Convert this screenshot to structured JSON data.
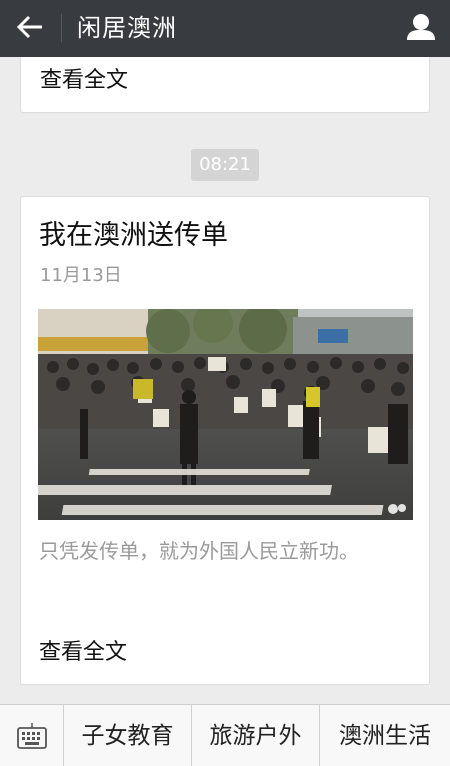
{
  "header": {
    "title": "闲居澳洲"
  },
  "feed": [
    {
      "read_more": "查看全文"
    },
    {
      "time": "08:21",
      "title": "我在澳洲送传单",
      "date": "11月13日",
      "summary": "只凭发传单，就为外国人民立新功。",
      "read_more": "查看全文"
    }
  ],
  "bottom_menu": [
    {
      "label": "子女教育"
    },
    {
      "label": "旅游户外"
    },
    {
      "label": "澳洲生活"
    }
  ]
}
